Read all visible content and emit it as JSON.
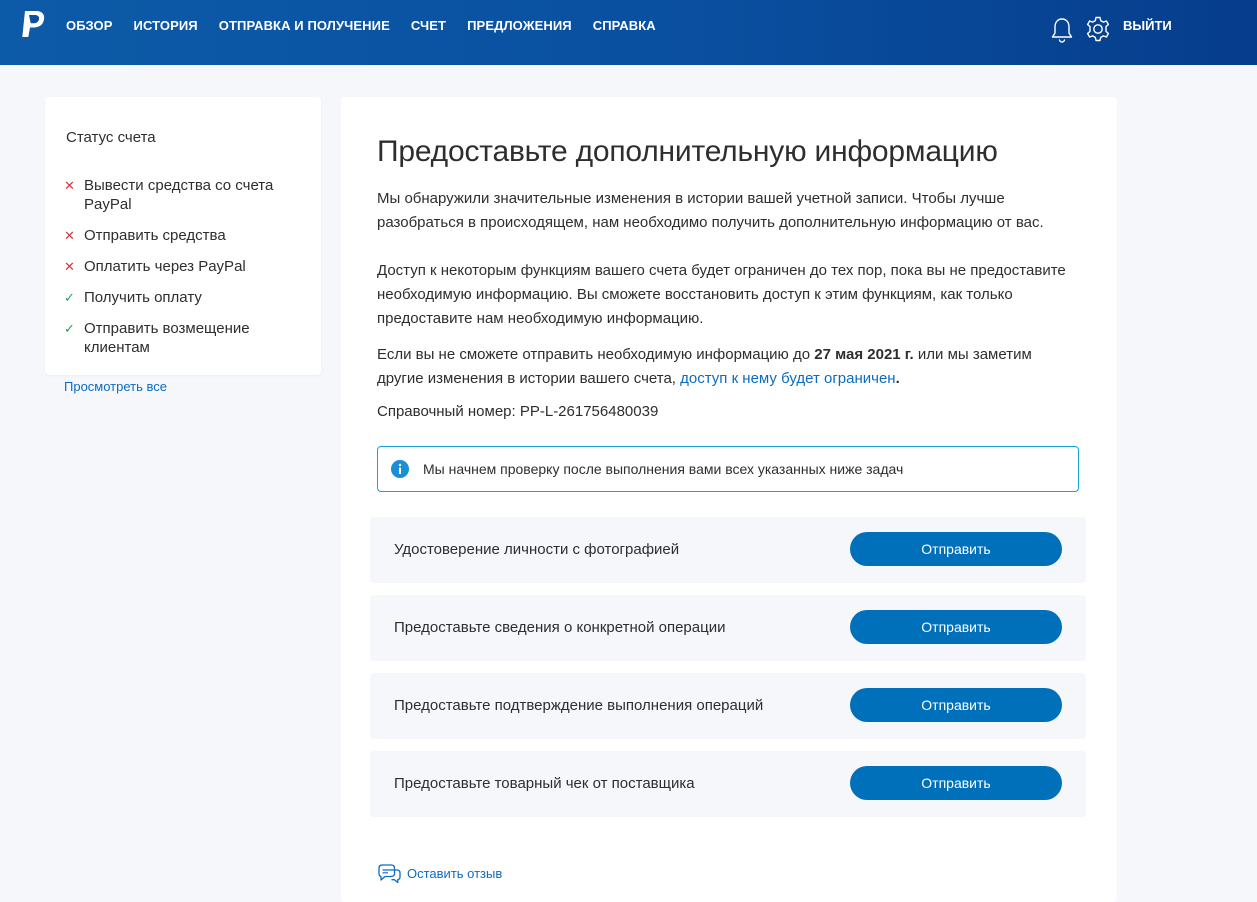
{
  "header": {
    "nav": [
      "ОБЗОР",
      "ИСТОРИЯ",
      "ОТПРАВКА И ПОЛУЧЕНИЕ",
      "СЧЕТ",
      "ПРЕДЛОЖЕНИЯ",
      "СПРАВКА"
    ],
    "logout": "ВЫЙТИ"
  },
  "sidebar": {
    "title": "Статус счета",
    "items": [
      {
        "label": "Вывести средства со счета PayPal",
        "status": "blocked"
      },
      {
        "label": "Отправить средства",
        "status": "blocked"
      },
      {
        "label": "Оплатить через PayPal",
        "status": "blocked"
      },
      {
        "label": "Получить оплату",
        "status": "allowed"
      },
      {
        "label": "Отправить возмещение клиентам",
        "status": "allowed"
      }
    ],
    "view_all": "Просмотреть все"
  },
  "main": {
    "title": "Предоставьте дополнительную информацию",
    "p1": "Мы обнаружили значительные изменения в истории вашей учетной записи. Чтобы лучше разобраться в происходящем, нам необходимо получить дополнительную информацию от вас.",
    "p2": "Доступ к некоторым функциям вашего счета будет ограничен до тех пор, пока вы не предоставите необходимую информацию. Вы сможете восстановить доступ к этим функциям, как только предоставите нам необходимую информацию.",
    "p3": {
      "before": "Если вы не сможете отправить необходимую информацию до ",
      "date": "27 мая 2021 г.",
      "middle": " или мы заметим другие изменения в истории вашего счета, ",
      "link": "доступ к нему будет ограничен",
      "after": "."
    },
    "reference_label": "Справочный номер:",
    "reference_value": "PP-L-261756480039",
    "info": "Мы начнем проверку после выполнения вами всех указанных ниже задач",
    "tasks": [
      {
        "label": "Удостоверение личности с фотографией",
        "button": "Отправить"
      },
      {
        "label": "Предоставьте сведения о конкретной операции",
        "button": "Отправить"
      },
      {
        "label": "Предоставьте подтверждение выполнения операций",
        "button": "Отправить"
      },
      {
        "label": "Предоставьте товарный чек от поставщика",
        "button": "Отправить"
      }
    ],
    "feedback": "Оставить отзыв"
  },
  "colors": {
    "header": "#0a4fa0",
    "button": "#0070ba",
    "link": "#0c6bc4",
    "info_border": "#1aa1d8",
    "blocked": "#d03a3a",
    "allowed": "#2a9d5f"
  }
}
